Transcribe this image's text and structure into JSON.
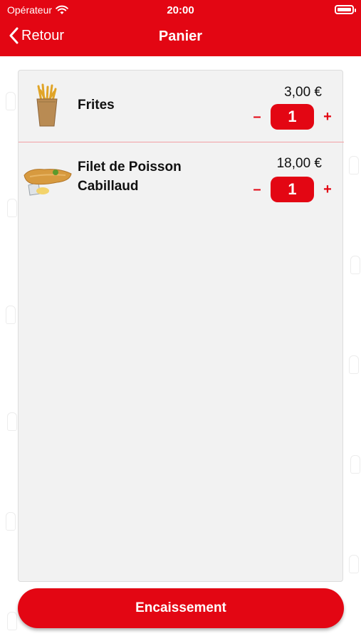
{
  "status_bar": {
    "carrier": "Opérateur",
    "time": "20:00"
  },
  "nav": {
    "back_label": "Retour",
    "title": "Panier"
  },
  "cart": {
    "items": [
      {
        "name": "Frites",
        "price": "3,00 €",
        "qty": "1",
        "minus": "–",
        "plus": "+"
      },
      {
        "name": "Filet de Poisson Cabillaud",
        "price": "18,00 €",
        "qty": "1",
        "minus": "–",
        "plus": "+"
      }
    ]
  },
  "checkout": {
    "label": "Encaissement"
  },
  "colors": {
    "brand": "#e30613",
    "panel_bg": "#f2f2f2",
    "divider": "#f1a0a4"
  }
}
